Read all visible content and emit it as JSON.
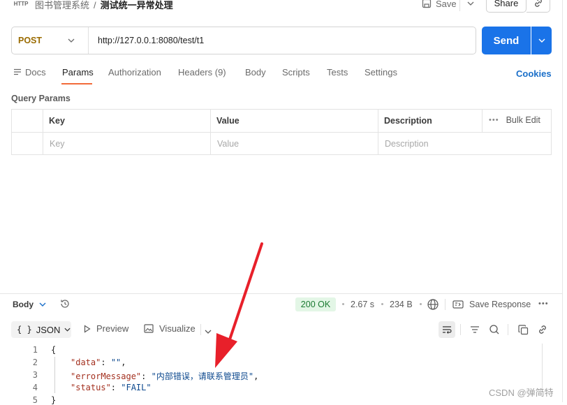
{
  "header": {
    "http_badge": "HTTP",
    "breadcrumb_parent": "图书管理系统",
    "breadcrumb_sep": "/",
    "breadcrumb_current": "测试统一异常处理",
    "save_label": "Save",
    "share_label": "Share"
  },
  "request": {
    "method": "POST",
    "url": "http://127.0.0.1:8080/test/t1",
    "send_label": "Send"
  },
  "tabs": [
    {
      "label": "Docs"
    },
    {
      "label": "Params",
      "active": true
    },
    {
      "label": "Authorization"
    },
    {
      "label": "Headers (9)"
    },
    {
      "label": "Body"
    },
    {
      "label": "Scripts"
    },
    {
      "label": "Tests"
    },
    {
      "label": "Settings"
    }
  ],
  "cookies_label": "Cookies",
  "query_params": {
    "title": "Query Params",
    "headers": [
      "Key",
      "Value",
      "Description"
    ],
    "placeholders": [
      "Key",
      "Value",
      "Description"
    ],
    "bulk_edit": "Bulk Edit"
  },
  "response": {
    "body_label": "Body",
    "status": "200 OK",
    "time": "2.67 s",
    "size": "234 B",
    "save_response": "Save Response",
    "format": "JSON",
    "preview": "Preview",
    "visualize": "Visualize",
    "lines": [
      {
        "n": "1",
        "text": "{"
      },
      {
        "n": "2",
        "key": "\"data\"",
        "val": "\"\""
      },
      {
        "n": "3",
        "key": "\"errorMessage\"",
        "val": "\"内部错误，请联系管理员\""
      },
      {
        "n": "4",
        "key": "\"status\"",
        "val": "\"FAIL\""
      },
      {
        "n": "5",
        "text": "}"
      }
    ]
  },
  "watermark": "CSDN @弹简特",
  "colors": {
    "accent": "#1a73e8",
    "method": "#9a6b00",
    "tab_underline": "#f26b3a",
    "status_bg": "#e3f6e6",
    "status_fg": "#1b7a32",
    "arrow": "#e8202a"
  }
}
